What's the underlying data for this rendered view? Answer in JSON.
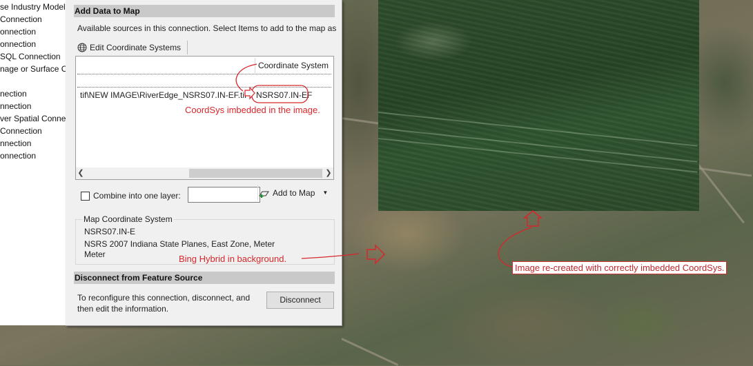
{
  "tree": {
    "items": [
      "se Industry Model",
      "Connection",
      "onnection",
      "onnection",
      "SQL Connection",
      "nage or Surface C",
      "",
      "nection",
      "nnection",
      "ver Spatial Conne",
      "Connection",
      "nnection",
      "onnection"
    ]
  },
  "dialog": {
    "add_data_header": "Add Data to Map",
    "hint": "Available sources in this connection.  Select Items to add to the map as",
    "edit_cs_label": "Edit Coordinate Systems",
    "grid": {
      "column_header": "Coordinate System",
      "row_path": "tif\\NEW IMAGE\\RiverEdge_NSRS07.IN-EF.tif",
      "row_cs": "NSRS07.IN-EF"
    },
    "combine_label": "Combine into one layer:",
    "add_to_map_label": "Add to Map",
    "map_cs_legend": "Map Coordinate System",
    "map_cs_code": "NSRS07.IN-E",
    "map_cs_name": "NSRS 2007 Indiana State Planes, East Zone, Meter",
    "map_cs_units": "Meter",
    "disconnect_header": "Disconnect from Feature Source",
    "reconfigure_text": "To reconfigure this connection, disconnect, and then edit the information.",
    "disconnect_label": "Disconnect"
  },
  "annotations": {
    "coordsys_note": "CoordSys imbedded in the image.",
    "bing_note": "Bing Hybrid in background.",
    "recreated_note": "Image re-created with correctly imbedded CoordSys."
  },
  "colors": {
    "annotation": "#d8262a",
    "section_header": "#c9c9c9",
    "dialog_bg": "#f0f0f0"
  }
}
